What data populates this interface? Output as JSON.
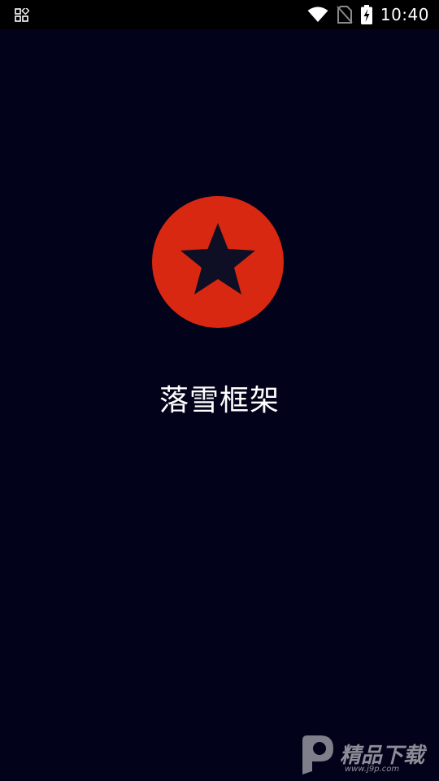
{
  "status_bar": {
    "time": "10:40",
    "icons": [
      "grid-notification-icon",
      "wifi-icon",
      "no-sim-icon",
      "battery-charging-icon"
    ]
  },
  "splash": {
    "app_name": "落雪框架",
    "icon": "red-star-circle-icon"
  },
  "watermark": {
    "brand": "精品下载",
    "url": "www.j9p.com"
  },
  "colors": {
    "background": "#02021a",
    "icon_red": "#d92812",
    "star_dark": "#0e0e24",
    "text": "#ffffff"
  }
}
